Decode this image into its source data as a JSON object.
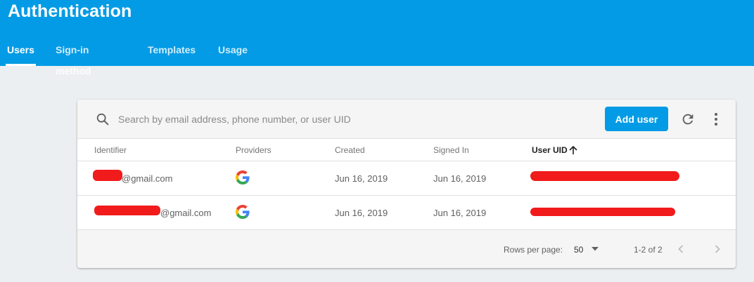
{
  "header": {
    "title": "Authentication",
    "tabs": [
      {
        "label": "Users",
        "active": true
      },
      {
        "label": "Sign-in method",
        "active": false
      },
      {
        "label": "Templates",
        "active": false
      },
      {
        "label": "Usage",
        "active": false
      }
    ]
  },
  "toolbar": {
    "search_placeholder": "Search by email address, phone number, or user UID",
    "add_user_label": "Add user",
    "icons": [
      "search-icon",
      "refresh-icon",
      "more-vert-icon"
    ]
  },
  "table": {
    "columns": [
      "Identifier",
      "Providers",
      "Created",
      "Signed In",
      "User UID"
    ],
    "sort": {
      "column": "User UID",
      "direction": "ascending"
    },
    "rows": [
      {
        "identifier": "@gmail.com",
        "provider": "google-icon",
        "created": "Jun 16, 2019",
        "signed_in": "Jun 16, 2019"
      },
      {
        "identifier": "@gmail.com",
        "provider": "google-icon",
        "created": "Jun 16, 2019",
        "signed_in": "Jun 16, 2019"
      }
    ]
  },
  "footer": {
    "rows_per_page_label": "Rows per page:",
    "rows_per_page_value": "50",
    "range": "1-2 of 2"
  },
  "colors": {
    "brand": "#039be5",
    "redaction": "#f11b1b"
  }
}
